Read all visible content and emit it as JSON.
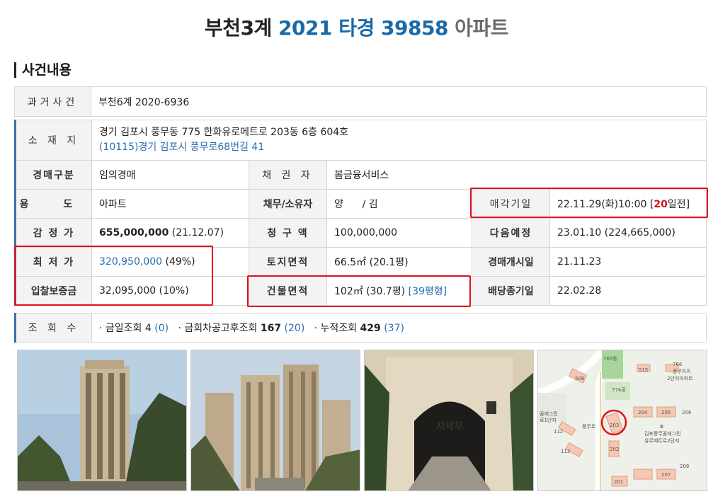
{
  "title": {
    "court": "부천3계",
    "case": "2021 타경 39858",
    "kind": "아파트"
  },
  "section": {
    "heading": "사건내용"
  },
  "past_case": {
    "label": "과거사건",
    "value": "부천6계 2020-6936"
  },
  "location": {
    "label": "소 재 지",
    "address": "경기 김포시 풍무동 775 한화유로메트로 203동 6층 604호",
    "road_address": "(10115)경기 김포시 풍무로68번길 41"
  },
  "rows": {
    "auction_type": {
      "label": "경매구분",
      "value": "임의경매"
    },
    "creditor": {
      "label": "채 권 자",
      "value": "봄금융서비스"
    },
    "usage": {
      "label": "용 도",
      "value": "아파트"
    },
    "debtor_owner": {
      "label": "채무/소유자",
      "value": "양      / 김"
    },
    "sale_date": {
      "label": "매각기일",
      "value": "22.11.29(화)10:00 [",
      "days": "20",
      "suffix": "일전]"
    },
    "appraisal": {
      "label": "감 정 가",
      "amount": "655,000,000",
      "date": "(21.12.07)"
    },
    "claim": {
      "label": "청 구 액",
      "value": "100,000,000"
    },
    "next_schedule": {
      "label": "다음예정",
      "value": "23.01.10 (224,665,000)"
    },
    "minimum": {
      "label": "최 저 가",
      "amount": "320,950,000",
      "pct": "(49%)"
    },
    "land_area": {
      "label": "토지면적",
      "value": "66.5㎡ (20.1평)"
    },
    "start_date": {
      "label": "경매개시일",
      "value": "21.11.23"
    },
    "deposit": {
      "label": "입찰보증금",
      "value": "32,095,000 (10%)"
    },
    "building_area": {
      "label": "건물면적",
      "value": "102㎡ (30.7평) ",
      "pyeong_type": "[39평형]"
    },
    "dividend_end": {
      "label": "배당종기일",
      "value": "22.02.28"
    }
  },
  "views": {
    "label": "조 회 수",
    "today": {
      "label": "· 금일조회",
      "count": "4",
      "sub": "(0)"
    },
    "after_notice": {
      "label": "· 금회차공고후조회",
      "count": "167",
      "sub": "(20)"
    },
    "total": {
      "label": "· 누적조회",
      "count": "429",
      "sub": "(37)"
    }
  },
  "map": {
    "labels": [
      "765동",
      "766",
      "풍무자이",
      "2단지아파트",
      "515",
      "506",
      "774공",
      "204",
      "205",
      "206",
      "203",
      "112",
      "113",
      "202",
      "201",
      "208",
      "207",
      "Ⅲ",
      "김포풍무꿈에그린",
      "유로메트로2단지",
      "풍무로",
      "꿈에그린",
      "로1단지"
    ]
  },
  "colors": {
    "accent_blue": "#1a6aa8",
    "highlight_red": "#e3111b",
    "label_bg": "#f3f3f3"
  }
}
